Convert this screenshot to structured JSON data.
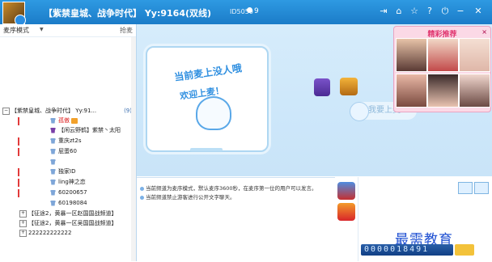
{
  "titlebar": {
    "title": "【紫禁皇城、战争时代】 Yy:9164(双线)",
    "channel_id": "ID5050",
    "user_count": "9",
    "buttons": [
      "menu-icon",
      "hat-icon",
      "star-icon",
      "help-icon",
      "power-icon",
      "minimize-icon",
      "close-icon"
    ]
  },
  "left": {
    "mode_label": "麦序模式",
    "grab_label": "抢麦",
    "channel_root": "【紫禁皇城、战争时代】 Yy:91...",
    "channel_count": "(9)",
    "users": [
      "孤傲",
      "【闲云野鹤】紫禁丶太阳",
      "重庆zt2s",
      "屁蛋60",
      "",
      "独家ID",
      "ling神之恋",
      "60200657",
      "60198084"
    ],
    "subchannels": [
      "【征途2，黄暴一区赵国国战频道】",
      "【征途2，黄暴一区吴国国战频道】",
      "222222222222"
    ]
  },
  "stage": {
    "board_line1": "当前麦上没人哦",
    "board_line2": "欢迎上麦！",
    "speak_label": "我要上麦"
  },
  "recommend": {
    "title": "精彩推荐",
    "close": "×"
  },
  "chat": {
    "line1": "当前频道为麦序模式，默认麦序3600秒，在麦序第一位的用户可以发言。",
    "line2": "当前频道禁止游客进行公开文字聊天。"
  },
  "watermark": "最需教育",
  "counter": "0000018491"
}
